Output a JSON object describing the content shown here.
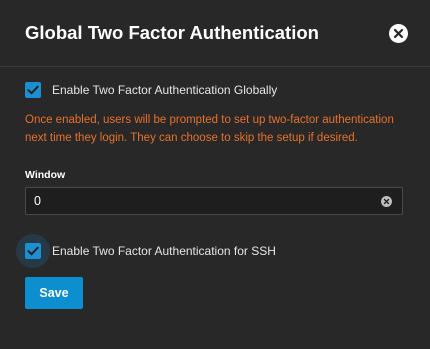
{
  "dialog": {
    "title": "Global Two Factor Authentication",
    "close_icon": "close-circle-icon"
  },
  "global_2fa": {
    "label": "Enable Two Factor Authentication Globally",
    "checked": true
  },
  "warning": {
    "line1": "Once enabled, users will be prompted to set up two-factor authentication",
    "line2": "next time they login. They can choose to skip the setup if desired.",
    "color": "#e8712a"
  },
  "window_field": {
    "label": "Window",
    "value": "0",
    "clear_icon": "clear-circle-icon"
  },
  "ssh_2fa": {
    "label": "Enable Two Factor Authentication for SSH",
    "checked": true
  },
  "actions": {
    "save_label": "Save"
  },
  "colors": {
    "background": "#282828",
    "accent": "#0d8ecf",
    "checkbox": "#1b8fd1",
    "warning": "#e8712a"
  }
}
